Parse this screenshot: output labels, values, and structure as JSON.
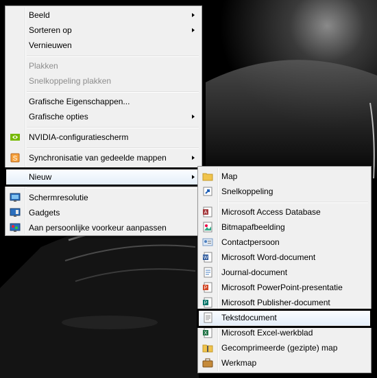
{
  "context_menu": {
    "items": [
      {
        "label": "Beeld",
        "submenu": true
      },
      {
        "label": "Sorteren op",
        "submenu": true
      },
      {
        "label": "Vernieuwen"
      },
      {
        "label": "Plakken",
        "disabled": true
      },
      {
        "label": "Snelkoppeling plakken",
        "disabled": true
      },
      {
        "label": "Grafische Eigenschappen..."
      },
      {
        "label": "Grafische opties",
        "submenu": true
      },
      {
        "label": "NVIDIA-configuratiescherm",
        "icon": "nvidia-icon"
      },
      {
        "label": "Synchronisatie van gedeelde mappen",
        "icon": "sync-icon",
        "submenu": true
      },
      {
        "label": "Nieuw",
        "submenu": true,
        "highlighted": true
      },
      {
        "label": "Schermresolutie",
        "icon": "screen-resolution-icon"
      },
      {
        "label": "Gadgets",
        "icon": "gadgets-icon"
      },
      {
        "label": "Aan persoonlijke voorkeur aanpassen",
        "icon": "personalize-icon"
      }
    ]
  },
  "new_submenu": {
    "items": [
      {
        "label": "Map",
        "icon": "folder-icon"
      },
      {
        "label": "Snelkoppeling",
        "icon": "shortcut-icon"
      },
      {
        "label": "Microsoft Access Database",
        "icon": "access-icon"
      },
      {
        "label": "Bitmapafbeelding",
        "icon": "bitmap-icon"
      },
      {
        "label": "Contactpersoon",
        "icon": "contact-icon"
      },
      {
        "label": "Microsoft Word-document",
        "icon": "word-icon"
      },
      {
        "label": "Journal-document",
        "icon": "journal-icon"
      },
      {
        "label": "Microsoft PowerPoint-presentatie",
        "icon": "powerpoint-icon"
      },
      {
        "label": "Microsoft Publisher-document",
        "icon": "publisher-icon"
      },
      {
        "label": "Tekstdocument",
        "icon": "text-document-icon",
        "highlighted": true
      },
      {
        "label": "Microsoft Excel-werkblad",
        "icon": "excel-icon"
      },
      {
        "label": "Gecomprimeerde (gezipte) map",
        "icon": "zip-folder-icon"
      },
      {
        "label": "Werkmap",
        "icon": "briefcase-icon"
      }
    ]
  }
}
